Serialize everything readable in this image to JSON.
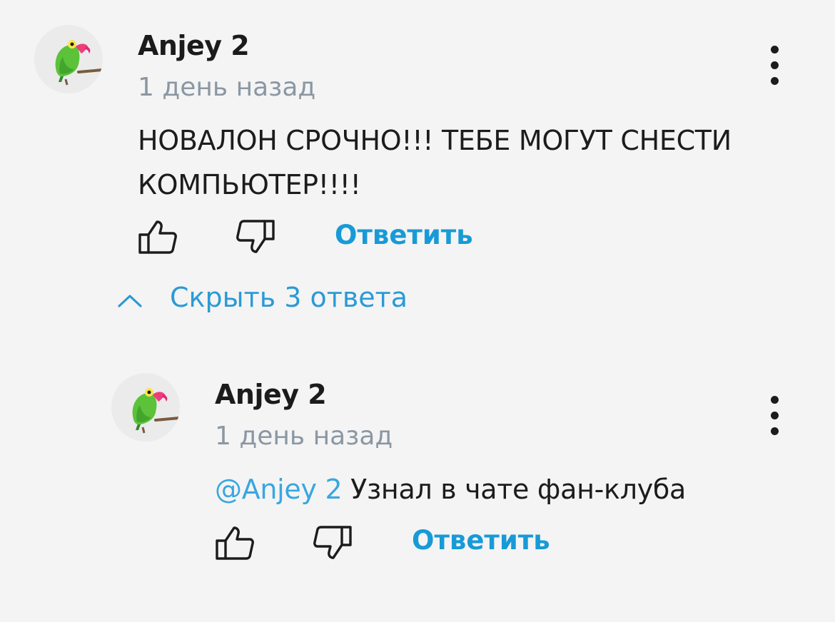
{
  "comments": [
    {
      "author": "Anjey 2",
      "time": "1 день назад",
      "text_lines": [
        "НОВАЛОН СРОЧНО!!! ТЕБЕ МОГУТ СНЕСТИ",
        "КОМПЬЮТЕР!!!!"
      ],
      "reply_label": "Ответить"
    },
    {
      "author": "Anjey 2",
      "time": "1 день назад",
      "mention": "@Anjey 2",
      "text": " Узнал в чате фан-клуба",
      "reply_label": "Ответить"
    }
  ],
  "replies_toggle": {
    "label": "Скрыть 3 ответа"
  },
  "icons": {
    "avatar": "parrot-avatar",
    "like": "thumbs-up-icon",
    "dislike": "thumbs-down-icon",
    "menu": "more-vertical-icon",
    "toggle": "chevron-up-icon"
  },
  "colors": {
    "background": "#f4f4f4",
    "accent": "#189ad7",
    "mention": "#38a7e0",
    "muted": "#8b97a3"
  }
}
